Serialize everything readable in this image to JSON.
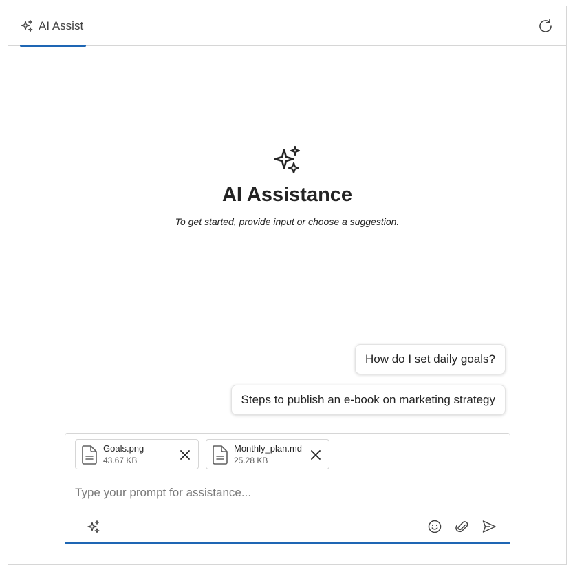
{
  "header": {
    "tab_label": "AI Assist",
    "tab_icon": "sparkle-icon",
    "refresh_icon": "refresh-icon"
  },
  "welcome": {
    "icon": "sparkle-icon",
    "title": "AI Assistance",
    "subtitle": "To get started, provide input or choose a suggestion."
  },
  "suggestions": [
    {
      "label": "How do I set daily goals?"
    },
    {
      "label": "Steps to publish an e-book on marketing strategy"
    }
  ],
  "composer": {
    "attachments": [
      {
        "name": "Goals.png",
        "size": "43.67 KB",
        "icon": "file-icon"
      },
      {
        "name": "Monthly_plan.md",
        "size": "25.28 KB",
        "icon": "file-icon"
      }
    ],
    "placeholder": "Type your prompt for assistance...",
    "value": "",
    "toolbar_icons": [
      "sparkle-icon",
      "emoji-icon",
      "paperclip-icon",
      "send-icon"
    ]
  },
  "colors": {
    "accent": "#1e66b4",
    "border": "#d6d6d6",
    "text": "#242424"
  }
}
